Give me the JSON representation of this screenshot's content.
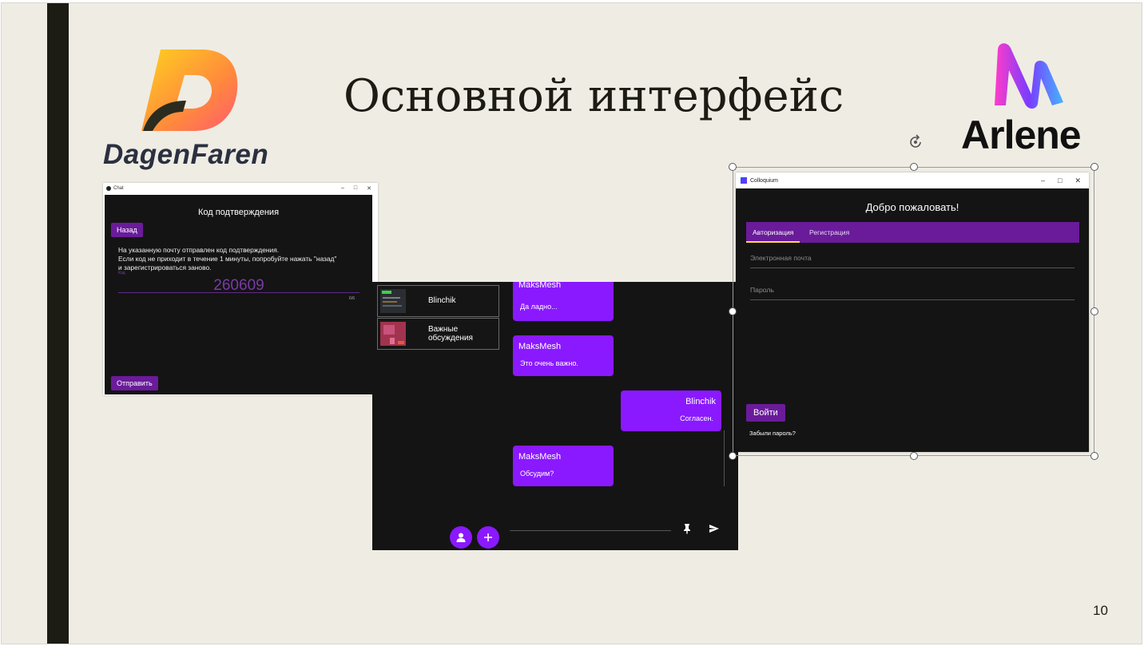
{
  "slide": {
    "title": "Основной интерфейс",
    "page_number": "10"
  },
  "logos": {
    "left": {
      "name": "DagenFaren",
      "letter": "D"
    },
    "right": {
      "name": "Arlene"
    }
  },
  "code_window": {
    "window_title": "Chat",
    "heading": "Код подтверждения",
    "back_button": "Назад",
    "message_lines": [
      "На указанную почту отправлен код подтверждения.",
      "Если код не приходит в течение 1 минуты, попробуйте нажать \"назад\"",
      "и зарегистрироваться заново."
    ],
    "field_hint": "Код",
    "code_value": "260609",
    "char_counter": "6/6",
    "send_button": "Отправить"
  },
  "chat_window": {
    "chats": [
      {
        "name": "Blinchik"
      },
      {
        "name_line1": "Важные",
        "name_line2": "обсуждения"
      }
    ],
    "messages": [
      {
        "author": "MaksMesh",
        "text": "Да ладно..."
      },
      {
        "author": "MaksMesh",
        "text": "Это очень важно."
      },
      {
        "author": "Blinchik",
        "text": "Согласен."
      },
      {
        "author": "MaksMesh",
        "text": "Обсудим?"
      }
    ],
    "icons": {
      "profile": "person-icon",
      "add": "plus-icon",
      "attach": "pin-icon",
      "send": "send-icon"
    }
  },
  "login_window": {
    "window_title": "Colloquium",
    "welcome": "Добро пожаловать!",
    "tabs": [
      "Авторизация",
      "Регистрация"
    ],
    "active_tab": "Авторизация",
    "email_placeholder": "Электронная почта",
    "password_placeholder": "Пароль",
    "login_button": "Войти",
    "forgot_link": "Забыли пароль?"
  },
  "colors": {
    "accent_purple": "#6a1b9a",
    "bubble_purple": "#8a19ff",
    "window_bg": "#141414",
    "slide_bg": "#efece4"
  }
}
